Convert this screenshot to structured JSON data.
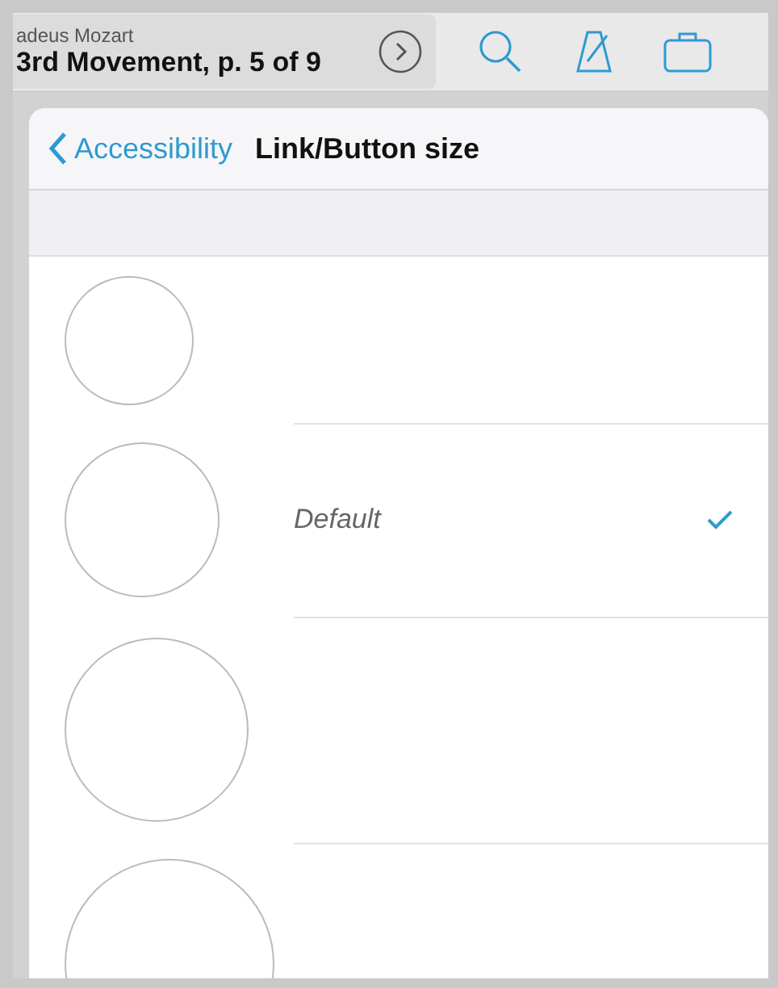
{
  "toolbar": {
    "subtitle": "adeus Mozart",
    "title": "3rd Movement, p. 5 of 9"
  },
  "popover": {
    "back_label": "Accessibility",
    "title": "Link/Button size",
    "options": [
      {
        "selected": false
      },
      {
        "label": "Default",
        "selected": true
      },
      {
        "selected": false
      },
      {
        "selected": false
      }
    ]
  }
}
